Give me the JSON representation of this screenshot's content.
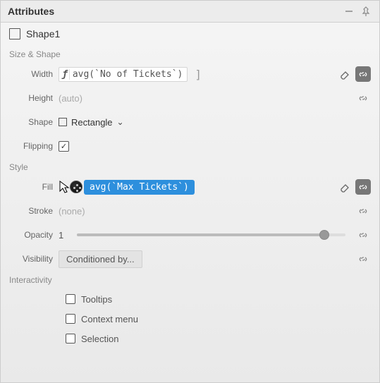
{
  "panel": {
    "title": "Attributes"
  },
  "shape": {
    "name": "Shape1"
  },
  "sections": {
    "sizeShape": "Size & Shape",
    "style": "Style",
    "interactivity": "Interactivity"
  },
  "labels": {
    "width": "Width",
    "height": "Height",
    "shape": "Shape",
    "flipping": "Flipping",
    "fill": "Fill",
    "stroke": "Stroke",
    "opacity": "Opacity",
    "visibility": "Visibility"
  },
  "values": {
    "widthExpr": "avg(`No of Tickets`)",
    "heightAuto": "(auto)",
    "shapeType": "Rectangle",
    "flipping": true,
    "fillExpr": "avg(`Max Tickets`)",
    "strokeNone": "(none)",
    "opacity": "1",
    "opacityPct": 92,
    "visibilityBtn": "Conditioned by..."
  },
  "interactivity": {
    "tooltips": {
      "label": "Tooltips",
      "checked": false
    },
    "contextMenu": {
      "label": "Context menu",
      "checked": false
    },
    "selection": {
      "label": "Selection",
      "checked": false
    }
  }
}
